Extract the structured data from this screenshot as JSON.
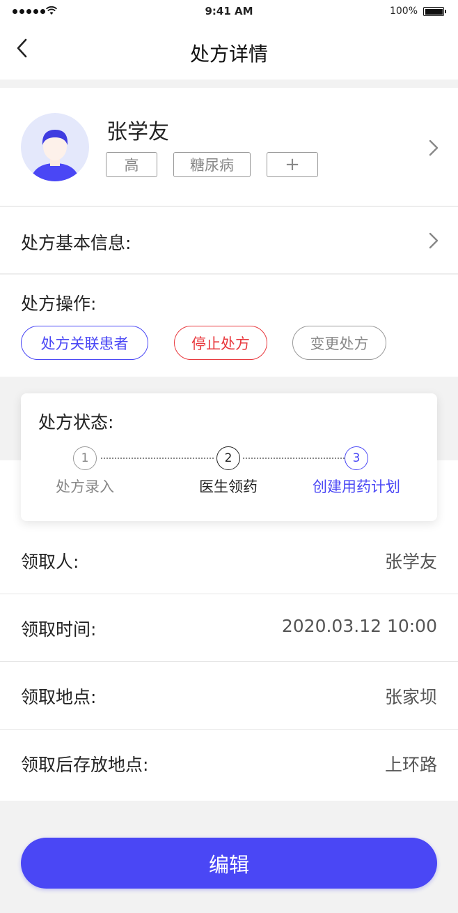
{
  "status_bar": {
    "time": "9:41 AM",
    "battery": "100%"
  },
  "nav": {
    "title": "处方详情"
  },
  "patient": {
    "name": "张学友",
    "tags": [
      "高",
      "糖尿病",
      "+"
    ]
  },
  "basic_info": {
    "label": "处方基本信息:"
  },
  "operations": {
    "label": "处方操作:",
    "buttons": [
      "处方关联患者",
      "停止处方",
      "变更处方"
    ]
  },
  "prescription_status": {
    "title": "处方状态:",
    "steps": [
      {
        "number": "1",
        "label": "处方录入"
      },
      {
        "number": "2",
        "label": "医生领药"
      },
      {
        "number": "3",
        "label": "创建用药计划"
      }
    ]
  },
  "details": [
    {
      "label": "领取人:",
      "value": "张学友"
    },
    {
      "label": "领取时间:",
      "value": "2020.03.12 10:00"
    },
    {
      "label": "领取地点:",
      "value": "张家坝"
    },
    {
      "label": "领取后存放地点:",
      "value": "上环路"
    }
  ],
  "edit_button": {
    "label": "编辑"
  },
  "colors": {
    "primary": "#4a47f5",
    "stop_red": "#e8383d",
    "muted_gray": "#888888",
    "avatar_bg": "#e4e8fb"
  }
}
